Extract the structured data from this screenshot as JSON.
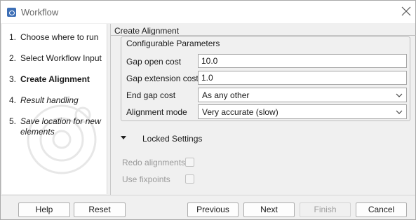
{
  "window": {
    "title": "Workflow"
  },
  "steps": [
    {
      "num": "1.",
      "label": "Choose where to run",
      "state": "done"
    },
    {
      "num": "2.",
      "label": "Select Workflow Input",
      "state": "done"
    },
    {
      "num": "3.",
      "label": "Create Alignment",
      "state": "current"
    },
    {
      "num": "4.",
      "label": "Result handling",
      "state": "future"
    },
    {
      "num": "5.",
      "label": "Save location for new elements",
      "state": "future"
    }
  ],
  "content": {
    "title": "Create Alignment",
    "configurable": {
      "legend": "Configurable Parameters",
      "gap_open": {
        "label": "Gap open cost",
        "value": "10.0"
      },
      "gap_extension": {
        "label": "Gap extension cost",
        "value": "1.0"
      },
      "end_gap": {
        "label": "End gap cost",
        "value": "As any other"
      },
      "alignment_mode": {
        "label": "Alignment mode",
        "value": "Very accurate (slow)"
      }
    },
    "locked": {
      "label": "Locked Settings",
      "redo_alignments": {
        "label": "Redo alignments",
        "checked": false
      },
      "use_fixpoints": {
        "label": "Use fixpoints",
        "checked": false
      }
    }
  },
  "buttons": {
    "help": "Help",
    "reset": "Reset",
    "previous": "Previous",
    "next": "Next",
    "finish": "Finish",
    "cancel": "Cancel"
  },
  "colors": {
    "app_icon": "#3d6fb6",
    "window_bg": "#f0f0f0",
    "disabled_text": "#a0a0a0"
  },
  "icons": {
    "app": "app-icon",
    "close": "close-icon",
    "dropdown": "chevron-down-icon",
    "expand": "triangle-down-icon"
  }
}
